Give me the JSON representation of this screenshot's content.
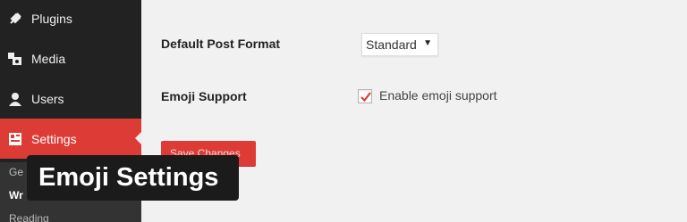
{
  "sidebar": {
    "items": [
      {
        "label": "Plugins",
        "icon": "plugin-icon",
        "active": false
      },
      {
        "label": "Media",
        "icon": "media-icon",
        "active": false
      },
      {
        "label": "Users",
        "icon": "users-icon",
        "active": false
      },
      {
        "label": "Settings",
        "icon": "settings-icon",
        "active": true
      }
    ],
    "submenu": [
      "Ge",
      "Wr",
      "Reading"
    ]
  },
  "settings": {
    "post_format_label": "Default Post Format",
    "post_format_value": "Standard",
    "emoji_label": "Emoji Support",
    "emoji_checkbox_label": "Enable emoji support",
    "emoji_checked": true,
    "save_label": "Save Changes"
  },
  "overlay_title": "Emoji Settings",
  "colors": {
    "sidebar_bg": "#222222",
    "accent": "#dd3c36",
    "content_bg": "#f1f1f1"
  }
}
